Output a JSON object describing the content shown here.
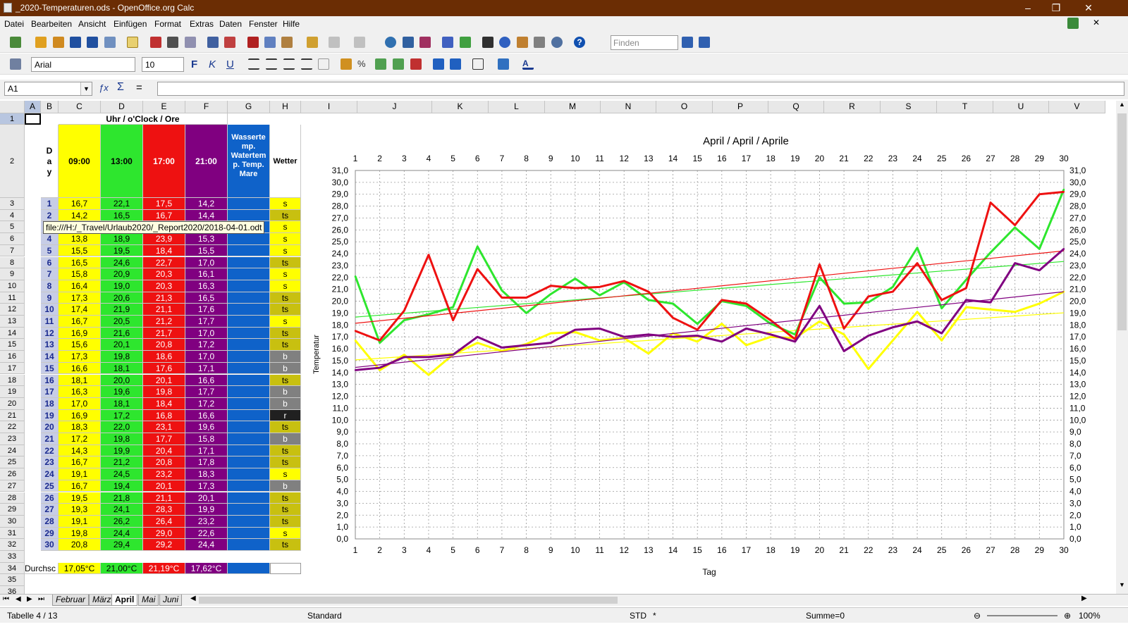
{
  "window": {
    "title": "_2020-Temperaturen.ods - OpenOffice.org Calc"
  },
  "menu": [
    "Datei",
    "Bearbeiten",
    "Ansicht",
    "Einfügen",
    "Format",
    "Extras",
    "Daten",
    "Fenster",
    "Hilfe"
  ],
  "toolbar": {
    "find_placeholder": "Finden",
    "font_name": "Arial",
    "font_size": "10"
  },
  "formula_bar": {
    "cell_ref": "A1",
    "value": ""
  },
  "columns": [
    "A",
    "B",
    "C",
    "D",
    "E",
    "F",
    "G",
    "H",
    "I",
    "J",
    "K",
    "L",
    "M",
    "N",
    "O",
    "P",
    "Q",
    "R",
    "S",
    "T",
    "U",
    "V"
  ],
  "sheet": {
    "title": "Uhr / o'Clock / Ore",
    "day_label": "Day",
    "headers": {
      "c": "09:00",
      "d": "13:00",
      "e": "17:00",
      "f": "21:00",
      "g": "Wasserte mp. Watertem p. Temp. Mare",
      "h": "Wetter"
    },
    "rows": [
      {
        "day": "1",
        "c": "16,7",
        "d": "22,1",
        "e": "17,5",
        "f": "14,2",
        "w": "s"
      },
      {
        "day": "2",
        "c": "14,2",
        "d": "16,5",
        "e": "16,7",
        "f": "14,4",
        "w": "ts"
      },
      {
        "day": "3",
        "c": "15,5",
        "d": "18,4",
        "e": "19,2",
        "f": "15,3",
        "w": "s"
      },
      {
        "day": "4",
        "c": "13,8",
        "d": "18,9",
        "e": "23,9",
        "f": "15,3",
        "w": "s"
      },
      {
        "day": "5",
        "c": "15,5",
        "d": "19,5",
        "e": "18,4",
        "f": "15,5",
        "w": "s"
      },
      {
        "day": "6",
        "c": "16,5",
        "d": "24,6",
        "e": "22,7",
        "f": "17,0",
        "w": "ts"
      },
      {
        "day": "7",
        "c": "15,8",
        "d": "20,9",
        "e": "20,3",
        "f": "16,1",
        "w": "s"
      },
      {
        "day": "8",
        "c": "16,4",
        "d": "19,0",
        "e": "20,3",
        "f": "16,3",
        "w": "s"
      },
      {
        "day": "9",
        "c": "17,3",
        "d": "20,6",
        "e": "21,3",
        "f": "16,5",
        "w": "ts"
      },
      {
        "day": "10",
        "c": "17,4",
        "d": "21,9",
        "e": "21,1",
        "f": "17,6",
        "w": "ts"
      },
      {
        "day": "11",
        "c": "16,7",
        "d": "20,5",
        "e": "21,2",
        "f": "17,7",
        "w": "s"
      },
      {
        "day": "12",
        "c": "16,9",
        "d": "21,6",
        "e": "21,7",
        "f": "17,0",
        "w": "ts"
      },
      {
        "day": "13",
        "c": "15,6",
        "d": "20,1",
        "e": "20,8",
        "f": "17,2",
        "w": "ts"
      },
      {
        "day": "14",
        "c": "17,3",
        "d": "19,8",
        "e": "18,6",
        "f": "17,0",
        "w": "b"
      },
      {
        "day": "15",
        "c": "16,6",
        "d": "18,1",
        "e": "17,6",
        "f": "17,1",
        "w": "b"
      },
      {
        "day": "16",
        "c": "18,1",
        "d": "20,0",
        "e": "20,1",
        "f": "16,6",
        "w": "ts"
      },
      {
        "day": "17",
        "c": "16,3",
        "d": "19,6",
        "e": "19,8",
        "f": "17,7",
        "w": "b"
      },
      {
        "day": "18",
        "c": "17,0",
        "d": "18,1",
        "e": "18,4",
        "f": "17,2",
        "w": "b"
      },
      {
        "day": "19",
        "c": "16,9",
        "d": "17,2",
        "e": "16,8",
        "f": "16,6",
        "w": "r"
      },
      {
        "day": "20",
        "c": "18,3",
        "d": "22,0",
        "e": "23,1",
        "f": "19,6",
        "w": "ts"
      },
      {
        "day": "21",
        "c": "17,2",
        "d": "19,8",
        "e": "17,7",
        "f": "15,8",
        "w": "b"
      },
      {
        "day": "22",
        "c": "14,3",
        "d": "19,9",
        "e": "20,4",
        "f": "17,1",
        "w": "ts"
      },
      {
        "day": "23",
        "c": "16,7",
        "d": "21,2",
        "e": "20,8",
        "f": "17,8",
        "w": "ts"
      },
      {
        "day": "24",
        "c": "19,1",
        "d": "24,5",
        "e": "23,2",
        "f": "18,3",
        "w": "s"
      },
      {
        "day": "25",
        "c": "16,7",
        "d": "19,4",
        "e": "20,1",
        "f": "17,3",
        "w": "b"
      },
      {
        "day": "26",
        "c": "19,5",
        "d": "21,8",
        "e": "21,1",
        "f": "20,1",
        "w": "ts"
      },
      {
        "day": "27",
        "c": "19,3",
        "d": "24,1",
        "e": "28,3",
        "f": "19,9",
        "w": "ts"
      },
      {
        "day": "28",
        "c": "19,1",
        "d": "26,2",
        "e": "26,4",
        "f": "23,2",
        "w": "ts"
      },
      {
        "day": "29",
        "c": "19,8",
        "d": "24,4",
        "e": "29,0",
        "f": "22,6",
        "w": "s"
      },
      {
        "day": "30",
        "c": "20,8",
        "d": "29,4",
        "e": "29,2",
        "f": "24,4",
        "w": "ts"
      }
    ],
    "avg_label": "Durchsc",
    "averages": {
      "c": "17,05°C",
      "d": "21,00°C",
      "e": "21,19°C",
      "f": "17,62°C"
    }
  },
  "tooltip": "file:///H:/_Travel/Urlaub2020/_Report2020/2018-04-01.odt",
  "sheet_tabs": [
    "Februar",
    "März",
    "April",
    "Mai",
    "Juni"
  ],
  "status": {
    "sheet": "Tabelle 4 / 13",
    "style": "Standard",
    "mode": "STD",
    "modified": "*",
    "sum": "Summe=0",
    "zoom": "100%"
  },
  "colors": {
    "yellow": "#ffff00",
    "green": "#2ee62e",
    "red": "#ee1111",
    "purple": "#800080",
    "blue": "#0f62c9",
    "titlebar": "#6b2d04"
  },
  "chart_data": {
    "type": "line",
    "title": "April / April / Aprile",
    "xlabel": "Tag",
    "ylabel": "Temperatur",
    "ylim": [
      0,
      31
    ],
    "y_step": 1,
    "grid": true,
    "x": [
      1,
      2,
      3,
      4,
      5,
      6,
      7,
      8,
      9,
      10,
      11,
      12,
      13,
      14,
      15,
      16,
      17,
      18,
      19,
      20,
      21,
      22,
      23,
      24,
      25,
      26,
      27,
      28,
      29,
      30
    ],
    "series": [
      {
        "color": "#ffff00",
        "values": [
          16.7,
          14.2,
          15.5,
          13.8,
          15.5,
          16.5,
          15.8,
          16.4,
          17.3,
          17.4,
          16.7,
          16.9,
          15.6,
          17.3,
          16.6,
          18.1,
          16.3,
          17.0,
          16.9,
          18.3,
          17.2,
          14.3,
          16.7,
          19.1,
          16.7,
          19.5,
          19.3,
          19.1,
          19.8,
          20.8
        ]
      },
      {
        "color": "#2ee62e",
        "values": [
          22.1,
          16.5,
          18.4,
          18.9,
          19.5,
          24.6,
          20.9,
          19.0,
          20.6,
          21.9,
          20.5,
          21.6,
          20.1,
          19.8,
          18.1,
          20.0,
          19.6,
          18.1,
          17.2,
          22.0,
          19.8,
          19.9,
          21.2,
          24.5,
          19.4,
          21.8,
          24.1,
          26.2,
          24.4,
          29.4
        ]
      },
      {
        "color": "#ee1111",
        "values": [
          17.5,
          16.7,
          19.2,
          23.9,
          18.4,
          22.7,
          20.3,
          20.3,
          21.3,
          21.1,
          21.2,
          21.7,
          20.8,
          18.6,
          17.6,
          20.1,
          19.8,
          18.4,
          16.8,
          23.1,
          17.7,
          20.4,
          20.8,
          23.2,
          20.1,
          21.1,
          28.3,
          26.4,
          29.0,
          29.2
        ]
      },
      {
        "color": "#800080",
        "values": [
          14.2,
          14.4,
          15.3,
          15.3,
          15.5,
          17.0,
          16.1,
          16.3,
          16.5,
          17.6,
          17.7,
          17.0,
          17.2,
          17.0,
          17.1,
          16.6,
          17.7,
          17.2,
          16.6,
          19.6,
          15.8,
          17.1,
          17.8,
          18.3,
          17.3,
          20.1,
          19.9,
          23.2,
          22.6,
          24.4
        ]
      }
    ],
    "trendlines": true
  }
}
